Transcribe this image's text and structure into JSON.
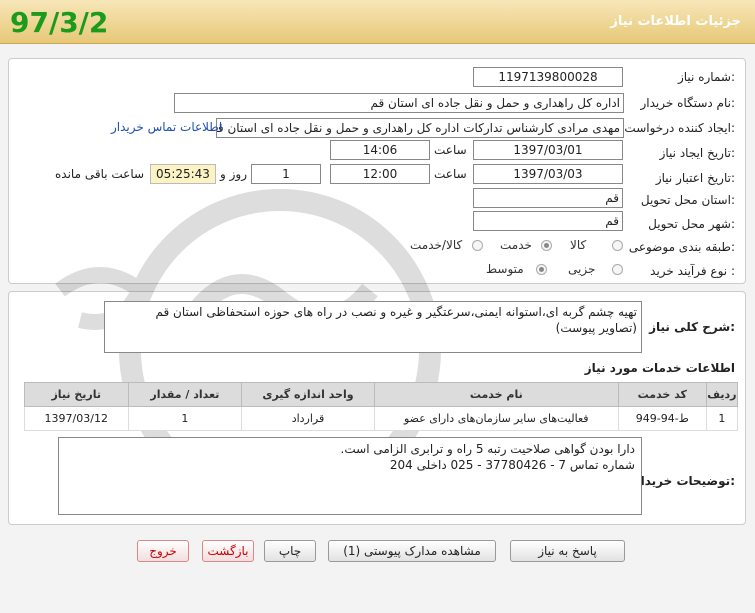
{
  "header": {
    "title": "جزئیات اطلاعات نیاز",
    "date_stamp": "97/3/2"
  },
  "form": {
    "need_number_label": "شماره نیاز:",
    "need_number": "1197139800028",
    "buyer_org_label": "نام دستگاه خریدار:",
    "buyer_org": "اداره کل راهداری و حمل و نقل جاده ای استان قم",
    "requester_label": "ایجاد کننده درخواست:",
    "requester": "مهدی مرادی کارشناس تدارکات اداره کل راهداری و حمل و نقل جاده ای استان قم",
    "contact_link": "اطلاعات تماس خریدار",
    "created_label": "تاریخ ایجاد نیاز:",
    "created_date": "1397/03/01",
    "time_label": "ساعت",
    "created_time": "14:06",
    "validity_label": "تاریخ اعتبار نیاز:",
    "validity_date": "1397/03/03",
    "validity_time": "12:00",
    "days_value": "1",
    "days_label": "روز و",
    "remaining_time": "05:25:43",
    "remaining_label": "ساعت باقی مانده",
    "province_label": "استان محل تحویل:",
    "province": "قم",
    "city_label": "شهر محل تحویل:",
    "city": "قم",
    "category_label": "طبقه بندی موضوعی:",
    "category_options": [
      "کالا",
      "خدمت",
      "کالا/خدمت"
    ],
    "category_selected": "خدمت",
    "process_label": "نوع فرآیند خرید :",
    "process_options": [
      "جزیی",
      "متوسط"
    ],
    "process_selected": "متوسط"
  },
  "summary": {
    "label": "شرح کلی نیاز:",
    "line1": "تهیه چشم گربه ای،استوانه ایمنی،سرعتگیر و غیره و نصب در راه های حوزه استحفاظی استان قم",
    "line2": "(تصاویر پیوست)"
  },
  "services": {
    "title": "اطلاعات خدمات مورد نیاز",
    "columns": [
      "ردیف",
      "کد خدمت",
      "نام خدمت",
      "واحد اندازه گیری",
      "تعداد / مقدار",
      "تاریخ نیاز"
    ],
    "rows": [
      [
        "1",
        "ط-94-949",
        "فعالیت‌های سایر سازمان‌های دارای عضو",
        "قرارداد",
        "1",
        "1397/03/12"
      ]
    ]
  },
  "buyer_notes": {
    "label": "توضیحات خریدار:",
    "line1": "دارا بودن گواهی صلاحیت رتبه 5 راه و ترابری الزامی است.",
    "line2": "شماره تماس 7 - 37780426 - 025 داخلی 204"
  },
  "buttons": {
    "reply": "پاسخ به نیاز",
    "attachments": "مشاهده مدارک پیوستی (1)",
    "print": "چاپ",
    "back": "بازگشت",
    "exit": "خروج"
  }
}
